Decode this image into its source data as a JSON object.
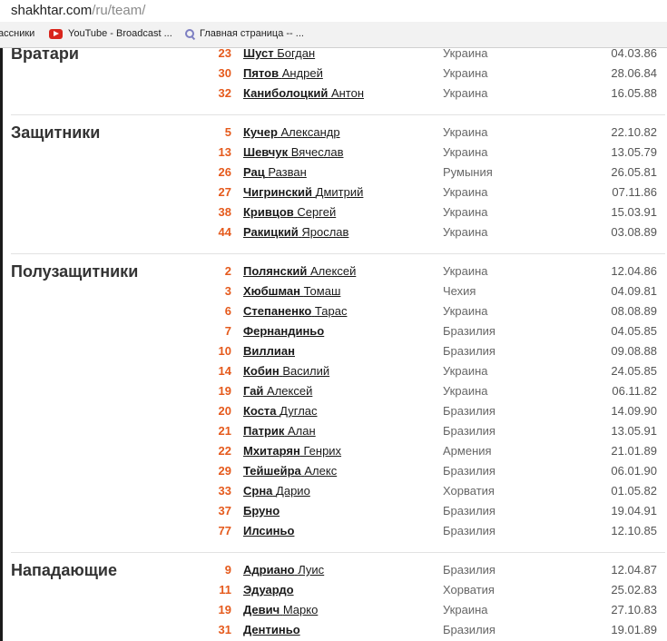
{
  "browser": {
    "url_domain": "shakhtar.com",
    "url_path": "/ru/team/",
    "bookmarks": [
      {
        "label": "ассники",
        "icon": "none"
      },
      {
        "label": "YouTube - Broadcast ...",
        "icon": "youtube-icon"
      },
      {
        "label": "Главная страница -- ...",
        "icon": "search-engine-icon"
      }
    ]
  },
  "colors": {
    "number": "#e55a1c",
    "text": "#1a1a1a",
    "country": "#666666"
  },
  "sections": [
    {
      "title": "Вратари",
      "players": [
        {
          "number": "23",
          "last": "Шуст",
          "first": "Богдан",
          "country": "Украина",
          "dob": "04.03.86"
        },
        {
          "number": "30",
          "last": "Пятов",
          "first": "Андрей",
          "country": "Украина",
          "dob": "28.06.84"
        },
        {
          "number": "32",
          "last": "Каниболоцкий",
          "first": "Антон",
          "country": "Украина",
          "dob": "16.05.88"
        }
      ]
    },
    {
      "title": "Защитники",
      "players": [
        {
          "number": "5",
          "last": "Кучер",
          "first": "Александр",
          "country": "Украина",
          "dob": "22.10.82"
        },
        {
          "number": "13",
          "last": "Шевчук",
          "first": "Вячеслав",
          "country": "Украина",
          "dob": "13.05.79"
        },
        {
          "number": "26",
          "last": "Рац",
          "first": "Разван",
          "country": "Румыния",
          "dob": "26.05.81"
        },
        {
          "number": "27",
          "last": "Чигринский",
          "first": "Дмитрий",
          "country": "Украина",
          "dob": "07.11.86"
        },
        {
          "number": "38",
          "last": "Кривцов",
          "first": " Сергей",
          "country": "Украина",
          "dob": "15.03.91"
        },
        {
          "number": "44",
          "last": "Ракицкий",
          "first": "Ярослав",
          "country": "Украина",
          "dob": "03.08.89"
        }
      ]
    },
    {
      "title": "Полузащитники",
      "players": [
        {
          "number": "2",
          "last": "Полянский",
          "first": "Алексей",
          "country": "Украина",
          "dob": "12.04.86"
        },
        {
          "number": "3",
          "last": "Хюбшман",
          "first": "Томаш",
          "country": "Чехия",
          "dob": "04.09.81"
        },
        {
          "number": "6",
          "last": "Степаненко",
          "first": " Тарас",
          "country": "Украина",
          "dob": "08.08.89"
        },
        {
          "number": "7",
          "last": "Фернандиньо",
          "first": " ",
          "country": "Бразилия",
          "dob": "04.05.85"
        },
        {
          "number": "10",
          "last": "Виллиан",
          "first": " ",
          "country": "Бразилия",
          "dob": "09.08.88"
        },
        {
          "number": "14",
          "last": "Кобин",
          "first": "Василий",
          "country": "Украина",
          "dob": "24.05.85"
        },
        {
          "number": "19",
          "last": "Гай",
          "first": "Алексей",
          "country": "Украина",
          "dob": "06.11.82"
        },
        {
          "number": "20",
          "last": "Коста",
          "first": "Дуглас",
          "country": "Бразилия",
          "dob": "14.09.90"
        },
        {
          "number": "21",
          "last": "Патрик",
          "first": "Алан",
          "country": "Бразилия",
          "dob": "13.05.91"
        },
        {
          "number": "22",
          "last": "Мхитарян",
          "first": "Генрих",
          "country": "Армения",
          "dob": "21.01.89"
        },
        {
          "number": "29",
          "last": "Тейшейра",
          "first": "Алекс",
          "country": "Бразилия",
          "dob": "06.01.90"
        },
        {
          "number": "33",
          "last": "Срна",
          "first": "Дарио",
          "country": "Хорватия",
          "dob": "01.05.82"
        },
        {
          "number": "37",
          "last": "Бруно",
          "first": " ",
          "country": "Бразилия",
          "dob": "19.04.91"
        },
        {
          "number": "77",
          "last": "Илсиньо",
          "first": " ",
          "country": "Бразилия",
          "dob": "12.10.85"
        }
      ]
    },
    {
      "title": "Нападающие",
      "players": [
        {
          "number": "9",
          "last": "Адриано",
          "first": "Луис",
          "country": "Бразилия",
          "dob": "12.04.87"
        },
        {
          "number": "11",
          "last": "Эдуардо",
          "first": " ",
          "country": "Хорватия",
          "dob": "25.02.83"
        },
        {
          "number": "19",
          "last": "Девич",
          "first": "Марко",
          "country": "Украина",
          "dob": "27.10.83"
        },
        {
          "number": "31",
          "last": "Дентиньо",
          "first": " ",
          "country": "Бразилия",
          "dob": "19.01.89"
        }
      ]
    }
  ]
}
